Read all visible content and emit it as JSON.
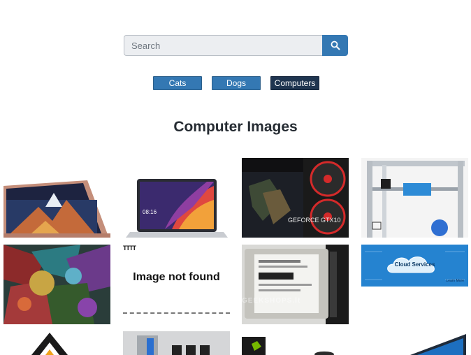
{
  "search": {
    "placeholder": "Search",
    "button_icon": "search-icon"
  },
  "categories": [
    {
      "label": "Cats",
      "active": false
    },
    {
      "label": "Dogs",
      "active": false
    },
    {
      "label": "Computers",
      "active": true
    }
  ],
  "section_title": "Computer Images",
  "images": {
    "broken_image_top": "TTTT",
    "broken_image_text": "Image not found",
    "cloud_text": "Cloud Services",
    "cloud_learn_more": "Learn More",
    "hdd_watermark": "GEEKSHOPS.lt",
    "gpu_text": "GEFORCE GTX10",
    "laptop_time": "08:16"
  },
  "colors": {
    "accent": "#3478b3",
    "active_category": "#1f3550",
    "title": "#262c33"
  }
}
